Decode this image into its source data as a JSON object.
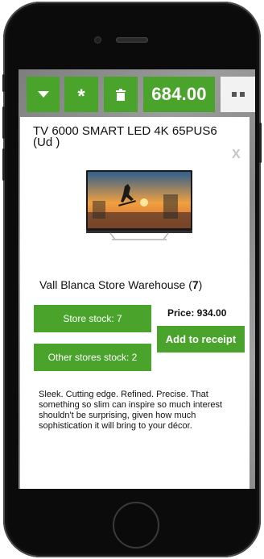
{
  "toolbar": {
    "total": "684.00"
  },
  "product": {
    "title": "TV 6000 SMART LED 4K 65PUS6 (Ud )",
    "close_label": "X",
    "store_name": "Vall Blanca Store Warehouse (",
    "store_count": "7",
    "store_suffix": ")",
    "store_stock_label": "Store stock: 7",
    "other_stock_label": "Other stores stock: 2",
    "price_label": "Price: 934.00",
    "add_label": "Add to receipt",
    "description": "Sleek. Cutting edge. Refined. Precise. That something so slim can inspire so much interest shouldn't be surprising, given how much sophistication it will bring to your décor."
  },
  "icons": {
    "dropdown": "caret-down-icon",
    "asterisk": "asterisk-icon",
    "trash": "trash-icon",
    "menu": "dots-menu-icon"
  },
  "colors": {
    "accent": "#4aa42c",
    "panel": "#ffffff",
    "frame": "#0b0b0b"
  }
}
